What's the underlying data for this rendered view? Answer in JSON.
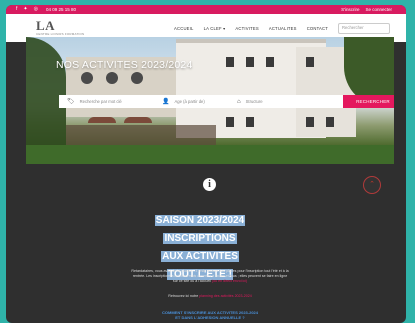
{
  "topbar": {
    "phone": "04 09 25 15 80",
    "account_links": [
      "S'inscrire",
      "Se connecter"
    ]
  },
  "header": {
    "logo_name": "LA CLEF",
    "logo_tagline": "CENTRE LOISIRS FORMATION",
    "nav": [
      "ACCUEIL",
      "LA CLEF ▾",
      "ACTIVITES",
      "ACTUALITES",
      "CONTACT"
    ],
    "search_placeholder": "Rechercher"
  },
  "hero": {
    "title": "NOS ACTIVITES 2023/2024",
    "search_fields": [
      {
        "icon": "tag-icon",
        "placeholder": "Recherche par mot clé"
      },
      {
        "icon": "person-icon",
        "placeholder": "Age (à partir de)"
      },
      {
        "icon": "home-icon",
        "placeholder": "Structure"
      }
    ],
    "search_button": "RECHERCHER"
  },
  "main": {
    "headline_lines": [
      "SAISON 2023/2024",
      "INSCRIPTIONS",
      "AUX ACTIVITES",
      "TOUT L'ETE !"
    ],
    "paragraph_1": "Retardataires, vous avez de la chance ! Il reste encore des places pour l'inscription tout l'été et à la rentrée. Les inscriptions sont désormais ouvertes à toutes et tous ; elles peuvent se faire en ligne sur ce site ou à l'accueil",
    "paragraph_1_link": "(ou en direct envoi ici)",
    "paragraph_2": "Retrouvez ici notre",
    "paragraph_2_link": "planning des activités 2023-2024",
    "cta_line_1": "COMMENT S'INSCRIRE AUX ACTIVITES 2023-2024",
    "cta_line_2": "ET DANS L'ADHESION ANNUELLE ?"
  },
  "colors": {
    "accent": "#e4185e",
    "page_bg": "#2fb3a9",
    "dark_section": "#2f2f2f",
    "headline_highlight": "#8ab0d6"
  }
}
